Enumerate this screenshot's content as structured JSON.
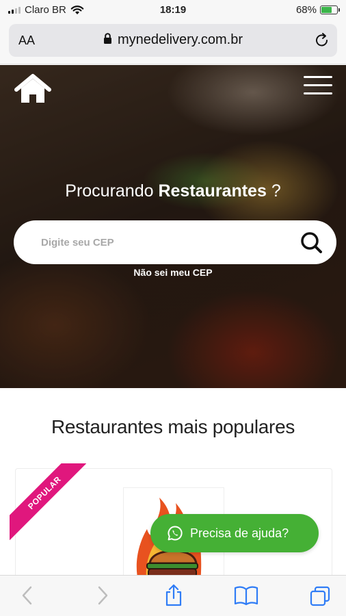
{
  "status_bar": {
    "carrier": "Claro BR",
    "time": "18:19",
    "battery": "68%",
    "battery_level": 0.68
  },
  "browser": {
    "text_size_label": "AA",
    "url": "mynedelivery.com.br"
  },
  "hero": {
    "title_prefix": "Procurando",
    "title_bold": "Restaurantes",
    "title_suffix": "?",
    "search_placeholder": "Digite seu CEP",
    "cep_link": "Não sei meu CEP"
  },
  "section": {
    "title": "Restaurantes mais populares",
    "badge": "POPULAR"
  },
  "whatsapp": {
    "label": "Precisa de ajuda?"
  },
  "colors": {
    "accent_green": "#45b035",
    "badge_pink": "#e0177d"
  },
  "icons": [
    "wifi-icon",
    "lock-icon",
    "reload-icon",
    "home-icon",
    "menu-icon",
    "search-icon",
    "whatsapp-icon",
    "back-icon",
    "forward-icon",
    "share-icon",
    "bookmarks-icon",
    "tabs-icon"
  ]
}
